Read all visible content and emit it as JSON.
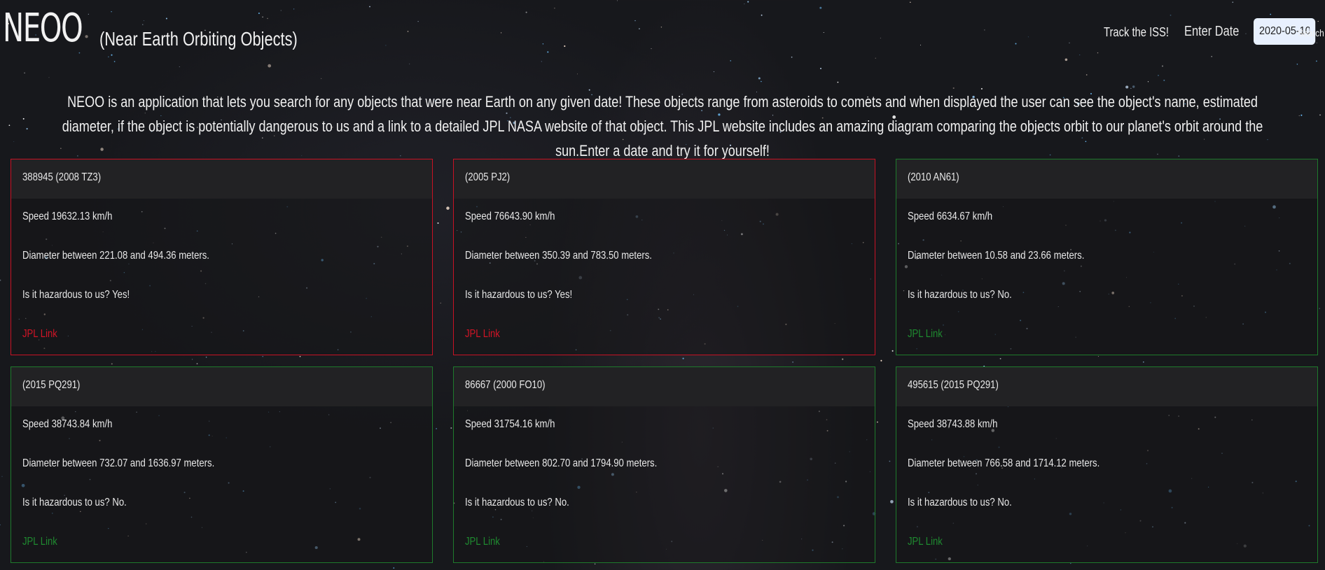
{
  "header": {
    "brand": "NEOO",
    "subtitle": "(Near Earth Orbiting Objects)",
    "nav": {
      "track_iss": "Track the ISS!",
      "date_label": "Enter Date",
      "date_value": "2020-05-10",
      "search_label": "Search"
    }
  },
  "intro": {
    "text": "NEOO is an application that lets you search for any objects that were near Earth on any given date! These objects range from asteroids to comets and when displayed the user can see the object's name, estimated diameter, if the object is potentially dangerous to us and a link to a detailed JPL NASA website of that object. This JPL website includes an amazing diagram comparing the objects orbit to our planet's orbit around the sun.Enter a date and try it for yourself!"
  },
  "colors": {
    "hazard_border": "#c81224",
    "safe_border": "#1e7a2c",
    "hazard_link": "#d21426",
    "safe_link": "#1f8a30"
  },
  "cards": [
    {
      "name": "388945 (2008 TZ3)",
      "speed": "Speed 19632.13 km/h",
      "diameter": "Diameter between 221.08 and 494.36 meters.",
      "hazard": "Is it hazardous to us? Yes!",
      "link": "JPL Link",
      "hazardous": true
    },
    {
      "name": "(2005 PJ2)",
      "speed": "Speed 76643.90 km/h",
      "diameter": "Diameter between 350.39 and 783.50 meters.",
      "hazard": "Is it hazardous to us? Yes!",
      "link": "JPL Link",
      "hazardous": true
    },
    {
      "name": "(2010 AN61)",
      "speed": "Speed 6634.67 km/h",
      "diameter": "Diameter between 10.58 and 23.66 meters.",
      "hazard": "Is it hazardous to us? No.",
      "link": "JPL Link",
      "hazardous": false
    },
    {
      "name": "(2015 PQ291)",
      "speed": "Speed 38743.84 km/h",
      "diameter": "Diameter between 732.07 and 1636.97 meters.",
      "hazard": "Is it hazardous to us? No.",
      "link": "JPL Link",
      "hazardous": false
    },
    {
      "name": "86667 (2000 FO10)",
      "speed": "Speed 31754.16 km/h",
      "diameter": "Diameter between 802.70 and 1794.90 meters.",
      "hazard": "Is it hazardous to us? No.",
      "link": "JPL Link",
      "hazardous": false
    },
    {
      "name": "495615 (2015 PQ291)",
      "speed": "Speed 38743.88 km/h",
      "diameter": "Diameter between 766.58 and 1714.12 meters.",
      "hazard": "Is it hazardous to us? No.",
      "link": "JPL Link",
      "hazardous": false
    }
  ]
}
